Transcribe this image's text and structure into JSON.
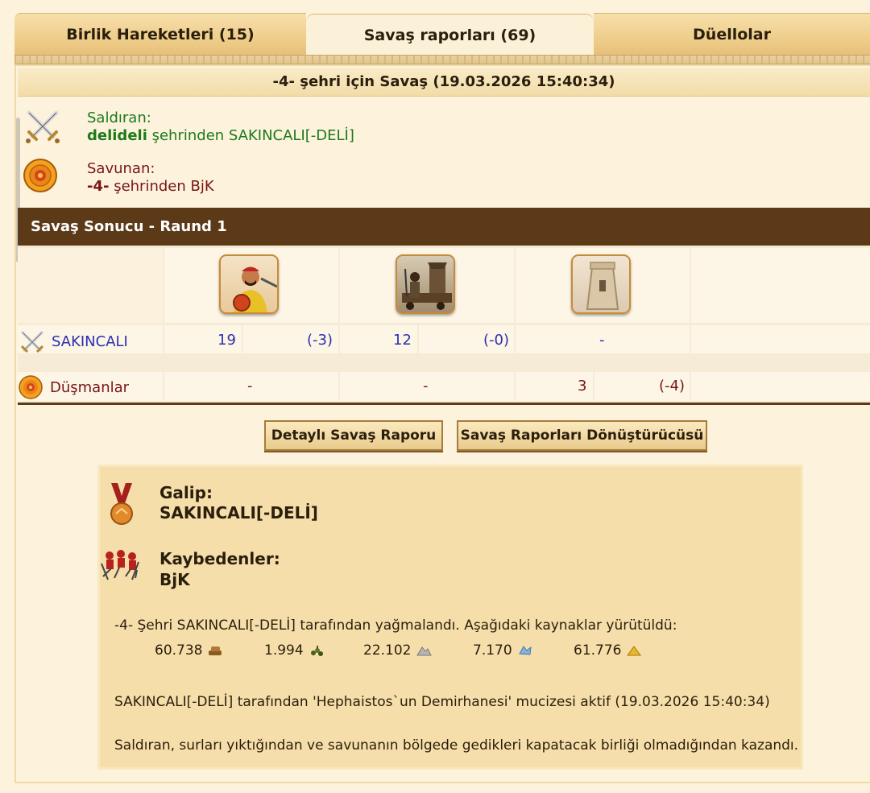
{
  "tabs": [
    {
      "label": "Birlik Hareketleri (15)"
    },
    {
      "label": "Savaş raporları (69)"
    },
    {
      "label": "Düellolar"
    }
  ],
  "report": {
    "title": "-4- şehri için Savaş (19.03.2026 15:40:34)",
    "attacker_heading": "Saldıran:",
    "attacker_city": "delideli",
    "attacker_rest": " şehrinden SAKINCALI[-DELİ]",
    "defender_heading": "Savunan:",
    "defender_city": "-4-",
    "defender_rest": " şehrinden BjK"
  },
  "result": {
    "round_title": "Savaş Sonucu - Raund 1",
    "attacker_row": {
      "name": "SAKINCALI",
      "u1": "19",
      "u1_loss": "(-3)",
      "u2": "12",
      "u2_loss": "(-0)",
      "u3": "-"
    },
    "enemy_row": {
      "name": "Düşmanlar",
      "u1": "-",
      "u2": "-",
      "u3": "3",
      "u3_loss": "(-4)"
    }
  },
  "buttons": {
    "detailed": "Detaylı Savaş Raporu",
    "converter": "Savaş Raporları Dönüştürücüsü"
  },
  "summary": {
    "winner_label": "Galip:",
    "winner_name": "SAKINCALI[-DELİ]",
    "losers_label": "Kaybedenler:",
    "losers_name": "BjK",
    "plunder_text": "-4- Şehri SAKINCALI[-DELİ] tarafından yağmalandı. Aşağıdaki kaynaklar yürütüldü:",
    "resources": [
      {
        "value": "60.738",
        "icon": "wood-icon"
      },
      {
        "value": "1.994",
        "icon": "wine-icon"
      },
      {
        "value": "22.102",
        "icon": "marble-icon"
      },
      {
        "value": "7.170",
        "icon": "crystal-icon"
      },
      {
        "value": "61.776",
        "icon": "sulfur-icon"
      }
    ],
    "wonder_text": "SAKINCALI[-DELİ] tarafından 'Hephaistos`un Demirhanesi' mucizesi aktif (19.03.2026 15:40:34)",
    "reason_text": "Saldıran, surları yıktığından ve savunanın bölgede gedikleri kapatacak birliği olmadığından kazandı."
  },
  "colors": {
    "header_brown": "#5c3a18",
    "attacker_green": "#1b7a1b",
    "defender_red": "#7a1515",
    "unit_blue": "#2b2fb0"
  }
}
